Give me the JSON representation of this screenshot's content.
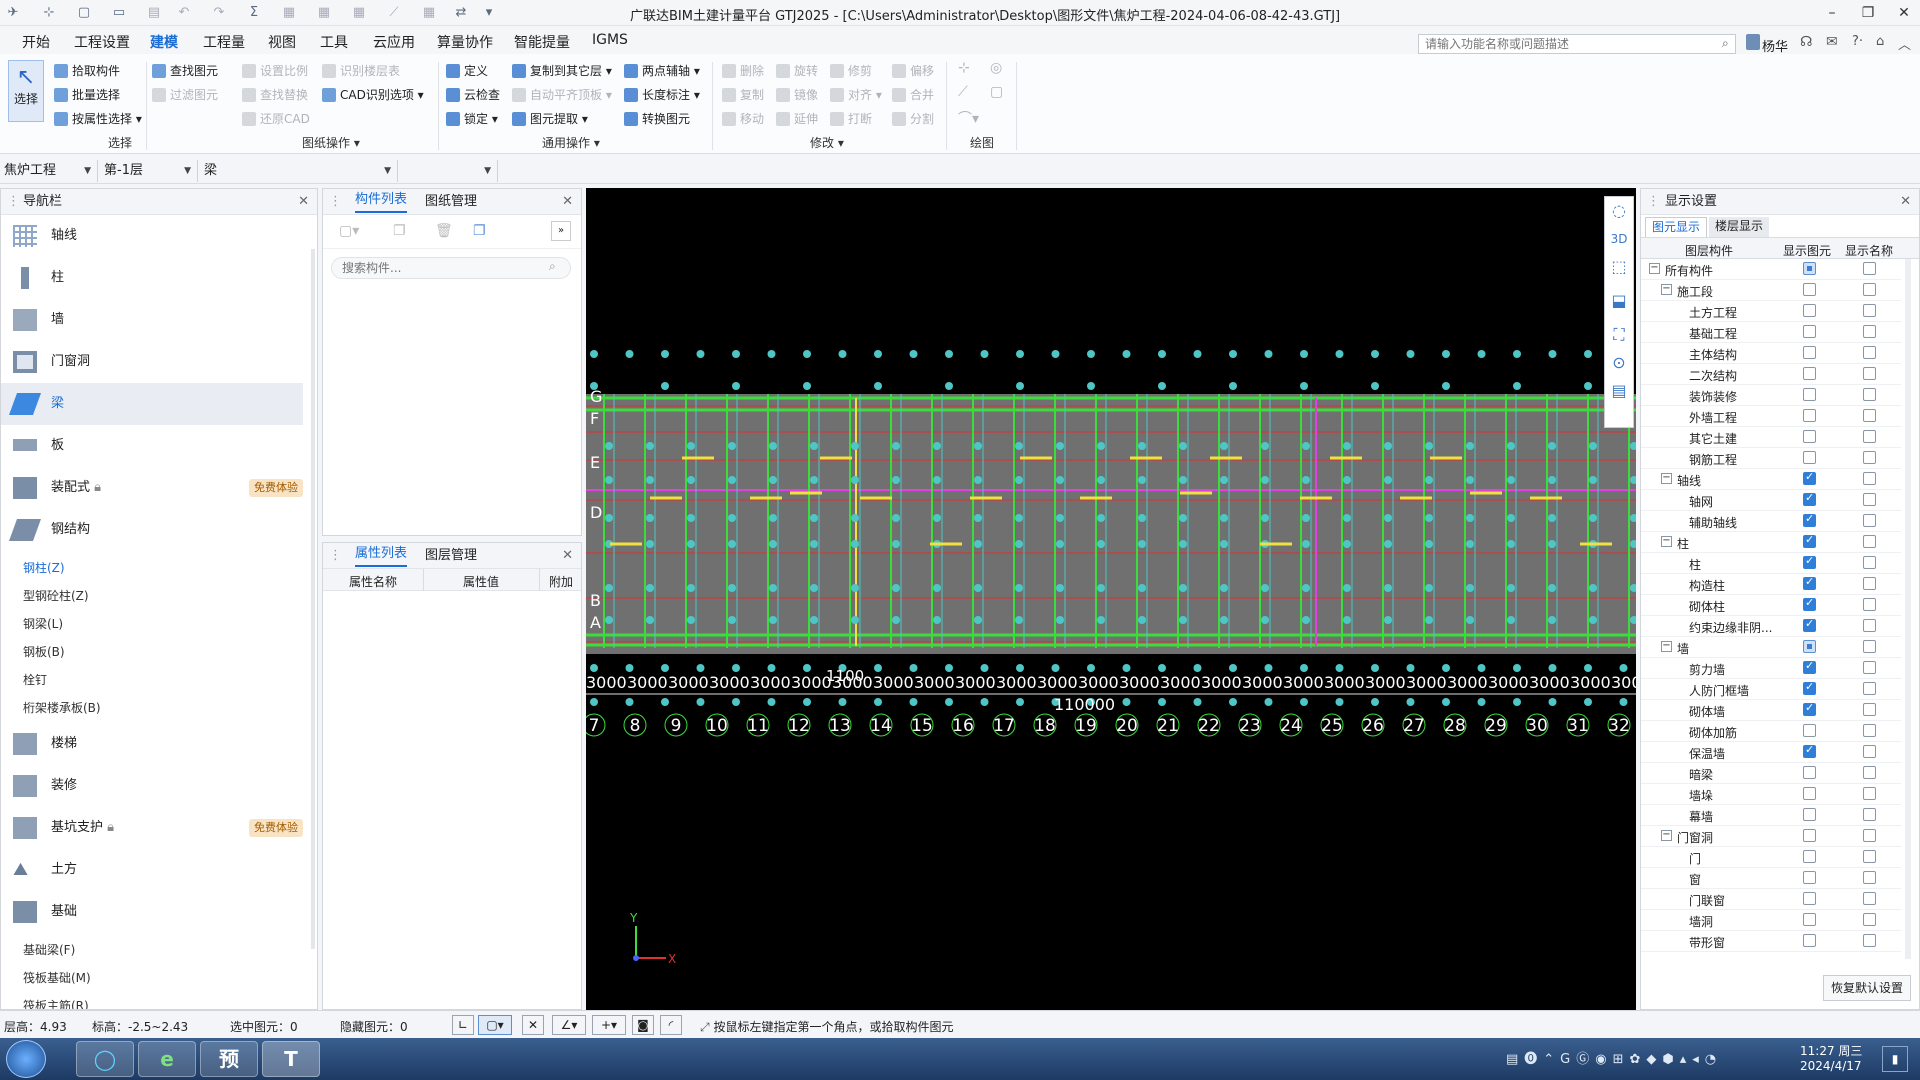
{
  "title": "广联达BIM土建计量平台 GTJ2025 - [C:\\Users\\Administrator\\Desktop\\图形文件\\焦炉工程-2024-04-06-08-42-43.GTJ]",
  "menu": [
    "开始",
    "工程设置",
    "建模",
    "工程量",
    "视图",
    "工具",
    "云应用",
    "算量协作",
    "智能提量",
    "IGMS"
  ],
  "search_placeholder": "请输入功能名称或问题描述",
  "user": "杨华",
  "ribbon": {
    "select_group": {
      "big": "选择",
      "items": [
        "拾取构件",
        "批量选择",
        "按属性选择"
      ],
      "label": "选择"
    },
    "drawing_group": {
      "col1": [
        "查找图元",
        "过滤图元"
      ],
      "col2": [
        "设置比例",
        "查找替换",
        "还原CAD"
      ],
      "col3": [
        "识别楼层表",
        "CAD识别选项"
      ],
      "label": "图纸操作"
    },
    "common_group": {
      "col1": [
        "定义",
        "云检查",
        "锁定"
      ],
      "col2": [
        "复制到其它层",
        "自动平齐顶板",
        "图元提取"
      ],
      "col3": [
        "两点辅轴",
        "长度标注",
        "转换图元"
      ],
      "label": "通用操作"
    },
    "modify_group": {
      "col1": [
        "删除",
        "复制",
        "移动"
      ],
      "col2": [
        "旋转",
        "镜像",
        "延伸"
      ],
      "col3": [
        "修剪",
        "对齐",
        "打断"
      ],
      "col4": [
        "偏移",
        "合并",
        "分割"
      ],
      "label": "修改"
    },
    "draw_group": {
      "label": "绘图"
    }
  },
  "selectors": {
    "project": "焦炉工程",
    "floor": "第-1层",
    "type": "梁",
    "sub": ""
  },
  "nav": {
    "title": "导航栏",
    "items": [
      "轴线",
      "柱",
      "墙",
      "门窗洞",
      "梁",
      "板",
      "装配式",
      "钢结构"
    ],
    "badge": "免费体验",
    "steel_sub": [
      "钢柱(Z)",
      "型钢砼柱(Z)",
      "钢梁(L)",
      "钢板(B)",
      "栓钉",
      "桁架楼承板(B)"
    ],
    "items2": [
      "楼梯",
      "装修",
      "基坑支护",
      "土方",
      "基础"
    ],
    "found_sub": [
      "基础梁(F)",
      "筏板基础(M)",
      "筏板主筋(R)"
    ]
  },
  "component_panel": {
    "tabs": [
      "构件列表",
      "图纸管理"
    ],
    "search_placeholder": "搜索构件..."
  },
  "property_panel": {
    "tabs": [
      "属性列表",
      "图层管理"
    ],
    "columns": [
      "属性名称",
      "属性值",
      "附加"
    ]
  },
  "canvas": {
    "axis_rows": [
      "G",
      "F",
      "E",
      "D",
      "B",
      "A"
    ],
    "axis_cols": [
      "7",
      "8",
      "9",
      "10",
      "11",
      "12",
      "13",
      "14",
      "15",
      "16",
      "17",
      "18",
      "19",
      "20",
      "21",
      "22",
      "23",
      "24",
      "25",
      "26",
      "27",
      "28",
      "29",
      "30",
      "31",
      "32"
    ],
    "dim_repeat": "3000",
    "dim_label_1": "1100",
    "total_dim": "110000",
    "colors": {
      "grid_red": "#e03030",
      "beam_green": "#3ddc3d",
      "column_teal": "#4fc6c6",
      "magenta": "#e040e0",
      "yellow": "#f0e040",
      "wall_gray": "#707070"
    }
  },
  "display": {
    "title": "显示设置",
    "tabs": [
      "图元显示",
      "楼层显示"
    ],
    "columns": [
      "图层构件",
      "显示图元",
      "显示名称"
    ],
    "rows": [
      {
        "name": "所有构件",
        "level": 0,
        "toggle": "−",
        "show": "part",
        "label": false
      },
      {
        "name": "施工段",
        "level": 1,
        "toggle": "−",
        "show": "off",
        "label": false
      },
      {
        "name": "土方工程",
        "level": 2,
        "show": "off",
        "label": false
      },
      {
        "name": "基础工程",
        "level": 2,
        "show": "off",
        "label": false
      },
      {
        "name": "主体结构",
        "level": 2,
        "show": "off",
        "label": false
      },
      {
        "name": "二次结构",
        "level": 2,
        "show": "off",
        "label": false
      },
      {
        "name": "装饰装修",
        "level": 2,
        "show": "off",
        "label": false
      },
      {
        "name": "外墙工程",
        "level": 2,
        "show": "off",
        "label": false
      },
      {
        "name": "其它土建",
        "level": 2,
        "show": "off",
        "label": false
      },
      {
        "name": "钢筋工程",
        "level": 2,
        "show": "off",
        "label": false
      },
      {
        "name": "轴线",
        "level": 1,
        "toggle": "−",
        "show": "on",
        "label": false
      },
      {
        "name": "轴网",
        "level": 2,
        "show": "on",
        "label": false
      },
      {
        "name": "辅助轴线",
        "level": 2,
        "show": "on",
        "label": false
      },
      {
        "name": "柱",
        "level": 1,
        "toggle": "−",
        "show": "on",
        "label": false
      },
      {
        "name": "柱",
        "level": 2,
        "show": "on",
        "label": false
      },
      {
        "name": "构造柱",
        "level": 2,
        "show": "on",
        "label": false
      },
      {
        "name": "砌体柱",
        "level": 2,
        "show": "on",
        "label": false
      },
      {
        "name": "约束边缘非阴...",
        "level": 2,
        "show": "on",
        "label": false
      },
      {
        "name": "墙",
        "level": 1,
        "toggle": "−",
        "show": "part",
        "label": false
      },
      {
        "name": "剪力墙",
        "level": 2,
        "show": "on",
        "label": false
      },
      {
        "name": "人防门框墙",
        "level": 2,
        "show": "on",
        "label": false
      },
      {
        "name": "砌体墙",
        "level": 2,
        "show": "on",
        "label": false
      },
      {
        "name": "砌体加筋",
        "level": 2,
        "show": "off",
        "label": false
      },
      {
        "name": "保温墙",
        "level": 2,
        "show": "on",
        "label": false
      },
      {
        "name": "暗梁",
        "level": 2,
        "show": "off",
        "label": false
      },
      {
        "name": "墙垛",
        "level": 2,
        "show": "off",
        "label": false
      },
      {
        "name": "幕墙",
        "level": 2,
        "show": "off",
        "label": false
      },
      {
        "name": "门窗洞",
        "level": 1,
        "toggle": "−",
        "show": "off",
        "label": false
      },
      {
        "name": "门",
        "level": 2,
        "show": "off",
        "label": false
      },
      {
        "name": "窗",
        "level": 2,
        "show": "off",
        "label": false
      },
      {
        "name": "门联窗",
        "level": 2,
        "show": "off",
        "label": false
      },
      {
        "name": "墙洞",
        "level": 2,
        "show": "off",
        "label": false
      },
      {
        "name": "带形窗",
        "level": 2,
        "show": "off",
        "label": false
      }
    ],
    "reset": "恢复默认设置"
  },
  "status": {
    "floor_height": "层高：4.93",
    "elevation": "标高：-2.5~2.43",
    "selected": "选中图元：0",
    "hidden": "隐藏图元：0",
    "hint": "按鼠标左键指定第一个角点，或拾取构件图元"
  },
  "taskbar": {
    "apps": [
      "◯",
      "e",
      "预",
      "T"
    ],
    "time": "11:27 周三",
    "date": "2024/4/17"
  }
}
